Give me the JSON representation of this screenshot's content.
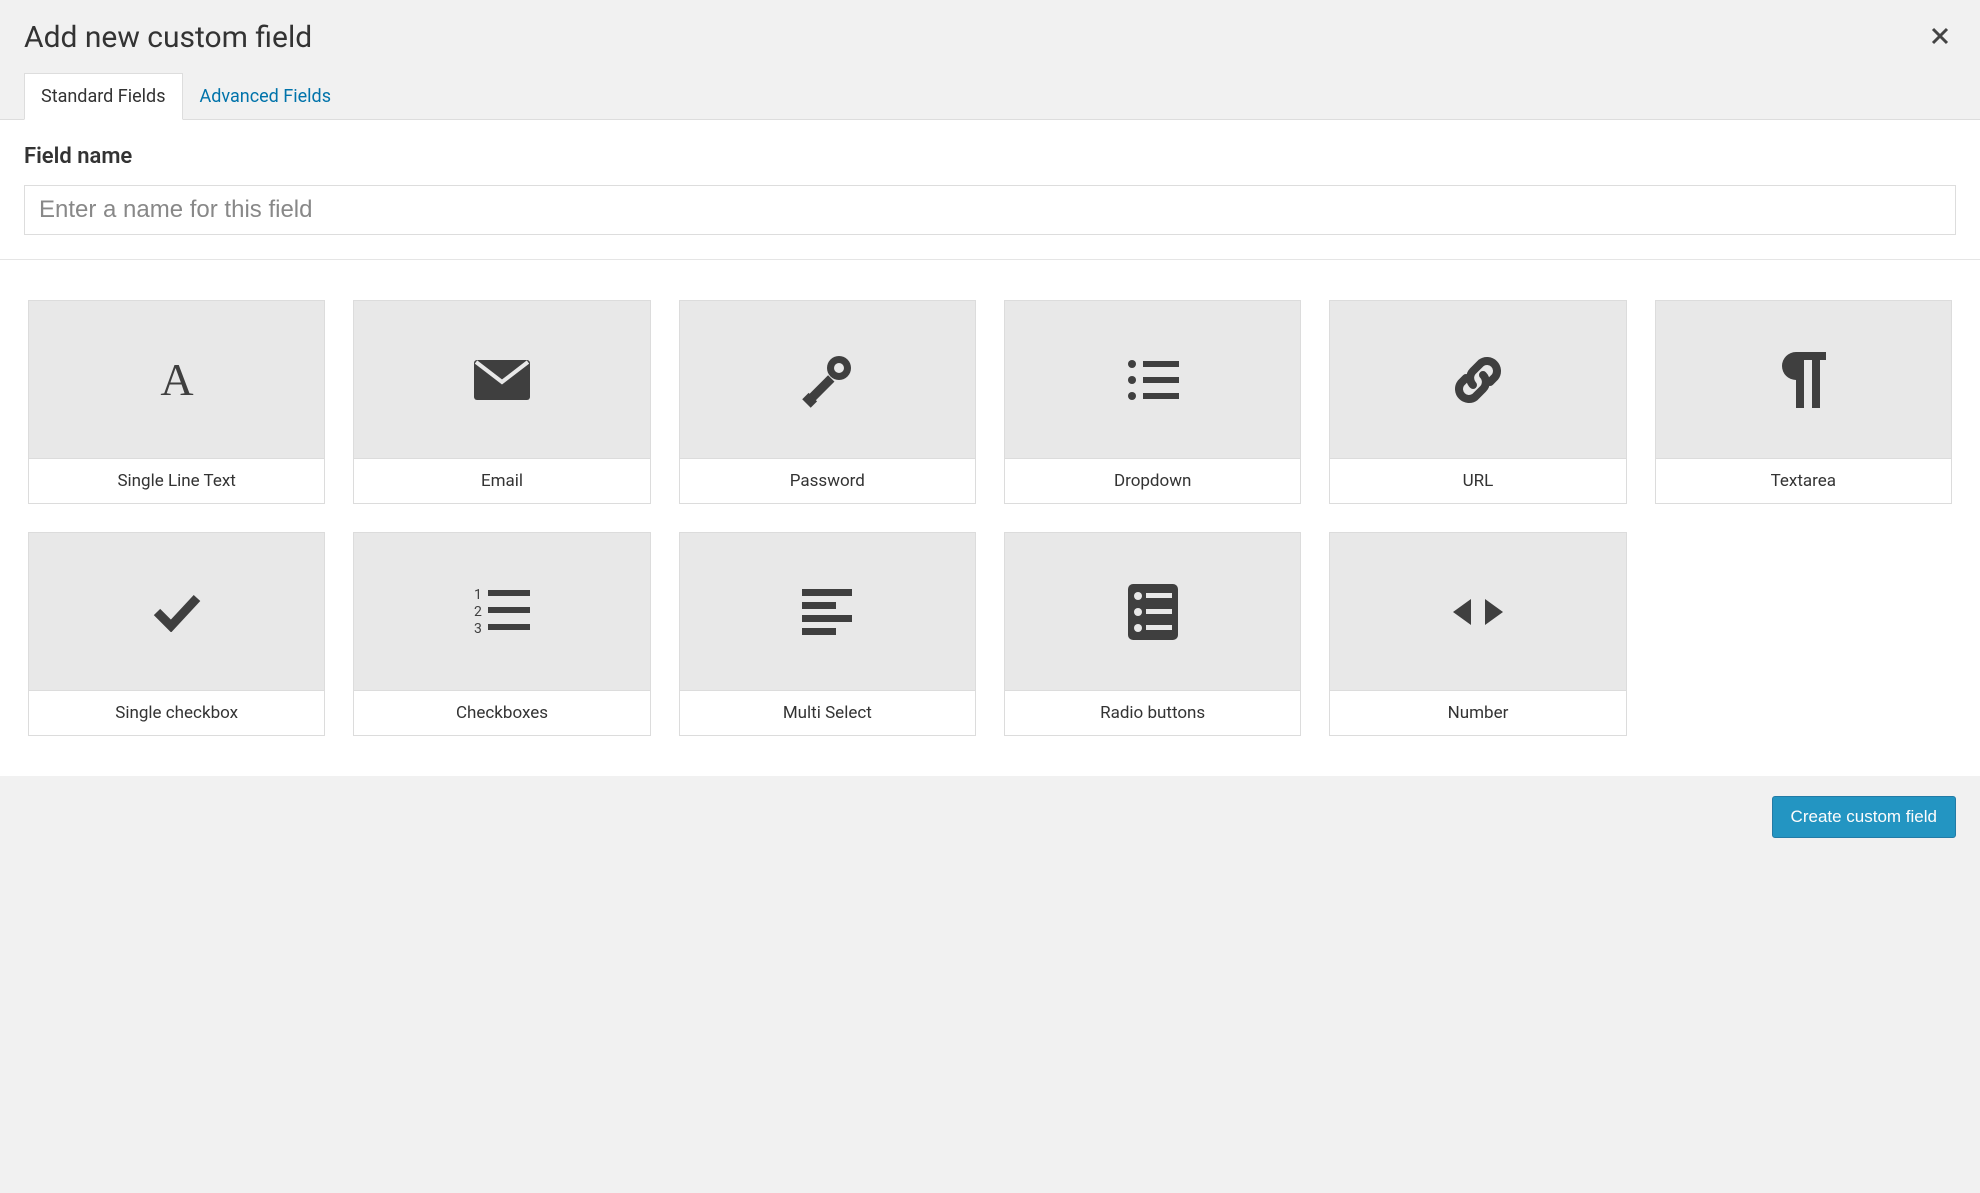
{
  "modal": {
    "title": "Add new custom field",
    "tabs": [
      {
        "label": "Standard Fields",
        "active": true
      },
      {
        "label": "Advanced Fields",
        "active": false
      }
    ],
    "field_name_label": "Field name",
    "field_name_placeholder": "Enter a name for this field",
    "field_name_value": ""
  },
  "field_types": [
    {
      "label": "Single Line Text",
      "icon": "letter-a"
    },
    {
      "label": "Email",
      "icon": "envelope"
    },
    {
      "label": "Password",
      "icon": "key"
    },
    {
      "label": "Dropdown",
      "icon": "list-ul"
    },
    {
      "label": "URL",
      "icon": "link"
    },
    {
      "label": "Textarea",
      "icon": "paragraph"
    },
    {
      "label": "Single checkbox",
      "icon": "check"
    },
    {
      "label": "Checkboxes",
      "icon": "list-ol"
    },
    {
      "label": "Multi Select",
      "icon": "align-left"
    },
    {
      "label": "Radio buttons",
      "icon": "list-radio"
    },
    {
      "label": "Number",
      "icon": "arrows-h"
    }
  ],
  "footer": {
    "create_button": "Create custom field"
  }
}
